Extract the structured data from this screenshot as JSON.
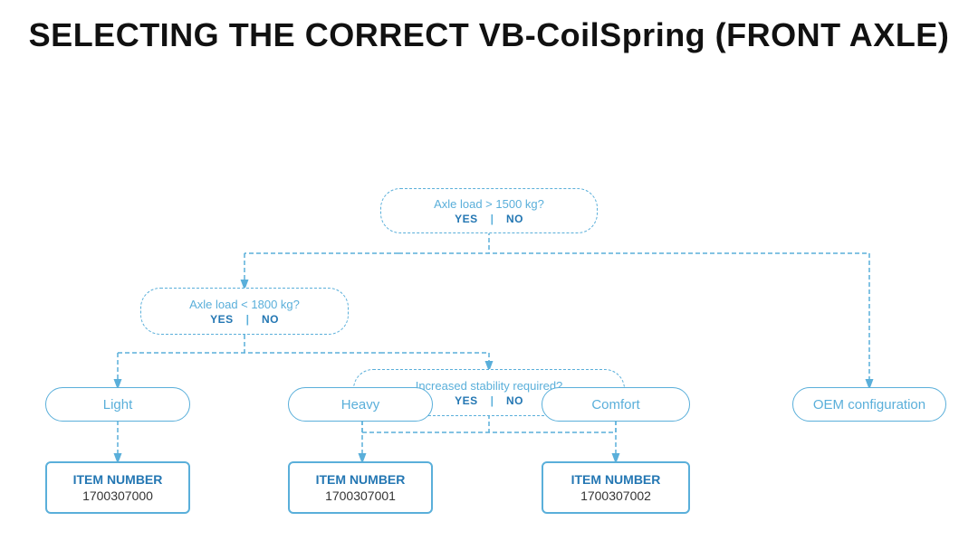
{
  "title": "SELECTING THE CORRECT VB-CoilSpring (FRONT AXLE)",
  "diagram": {
    "decision1": {
      "text": "Axle load > 1500 kg?",
      "yes": "YES",
      "no": "NO"
    },
    "decision2": {
      "text": "Axle load < 1800 kg?",
      "yes": "YES",
      "no": "NO"
    },
    "decision3": {
      "text": "Increased stability required?",
      "yes": "YES",
      "no": "NO"
    },
    "result_light": "Light",
    "result_heavy": "Heavy",
    "result_comfort": "Comfort",
    "result_oem": "OEM configuration",
    "item1": {
      "label": "ITEM NUMBER",
      "number": "1700307000"
    },
    "item2": {
      "label": "ITEM NUMBER",
      "number": "1700307001"
    },
    "item3": {
      "label": "ITEM NUMBER",
      "number": "1700307002"
    }
  }
}
